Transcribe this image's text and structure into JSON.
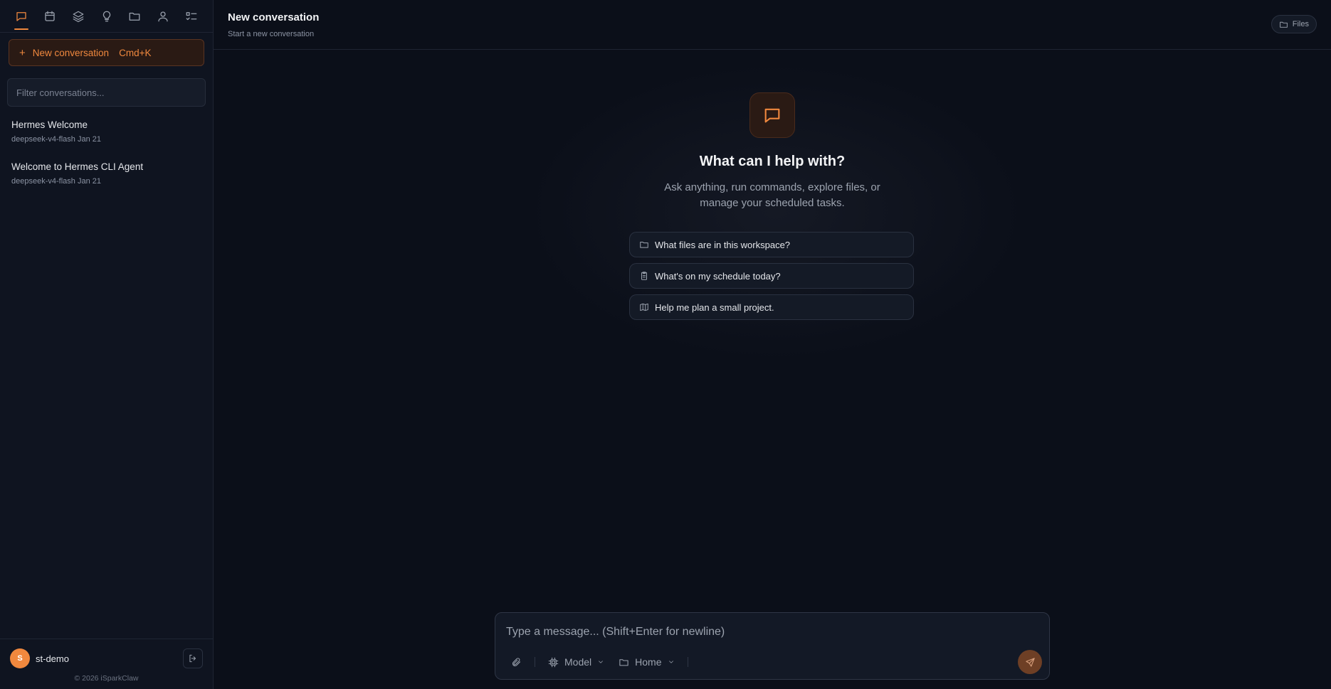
{
  "sidebar": {
    "nav_icons": [
      "chat-icon",
      "calendar-icon",
      "layers-icon",
      "lightbulb-icon",
      "folder-icon",
      "user-icon",
      "checklist-icon"
    ],
    "new_conversation": {
      "label": "New conversation",
      "shortcut": "Cmd+K"
    },
    "filter_placeholder": "Filter conversations...",
    "conversations": [
      {
        "title": "Hermes Welcome",
        "model": "deepseek-v4-flash",
        "date": "Jan 21"
      },
      {
        "title": "Welcome to Hermes CLI Agent",
        "model": "deepseek-v4-flash",
        "date": "Jan 21"
      }
    ],
    "user": {
      "initial": "S",
      "name": "st-demo"
    },
    "copyright": "© 2026 iSparkClaw"
  },
  "header": {
    "title": "New conversation",
    "subtitle": "Start a new conversation",
    "files_label": "Files"
  },
  "hero": {
    "title": "What can I help with?",
    "description": "Ask anything, run commands, explore files, or manage your scheduled tasks."
  },
  "suggestions": [
    {
      "icon": "folder-icon",
      "label": "What files are in this workspace?"
    },
    {
      "icon": "clipboard-icon",
      "label": "What's on my schedule today?"
    },
    {
      "icon": "map-icon",
      "label": "Help me plan a small project."
    }
  ],
  "composer": {
    "placeholder": "Type a message... (Shift+Enter for newline)",
    "model_label": "Model",
    "workspace_label": "Home"
  },
  "colors": {
    "accent": "#f0883e",
    "background": "#0b0f19",
    "sidebar": "#0f1420"
  }
}
